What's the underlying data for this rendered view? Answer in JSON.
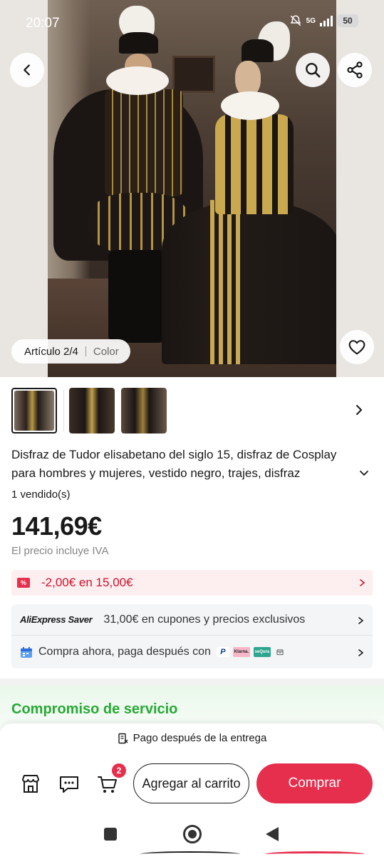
{
  "status_bar": {
    "time": "20:07",
    "network": "5G",
    "battery": "50"
  },
  "hero": {
    "counter": "Artículo 2/4",
    "color_label": "Color",
    "icons": [
      "back-arrow-icon",
      "search-icon",
      "share-icon",
      "heart-icon"
    ]
  },
  "thumbnails": {
    "count": 3,
    "selected_index": 0
  },
  "product": {
    "title": "Disfraz de Tudor elisabetano del siglo 15, disfraz de Cosplay para hombres y mujeres, vestido negro, trajes, disfraz renacentista",
    "sold": "1 vendido(s)",
    "price": "141,69€",
    "tax_note": "El precio incluye IVA"
  },
  "coupon": {
    "badge": "%",
    "text": "-2,00€ en 15,00€",
    "color": "#d0112b"
  },
  "saver": {
    "logo": "AliExpress Saver",
    "text": "31,00€ en cupones y precios exclusivos"
  },
  "pay_later": {
    "text": "Compra ahora, paga después con",
    "logos": [
      "P",
      "Klarna.",
      "seQura"
    ]
  },
  "service": {
    "title": "Compromiso de servicio",
    "color": "#27a935"
  },
  "bottom": {
    "pay_after_delivery": "Pago después de la entrega",
    "cart_badge": "2",
    "add_to_cart": "Agregar al carrito",
    "buy": "Comprar",
    "accent": "#e62e4d"
  }
}
